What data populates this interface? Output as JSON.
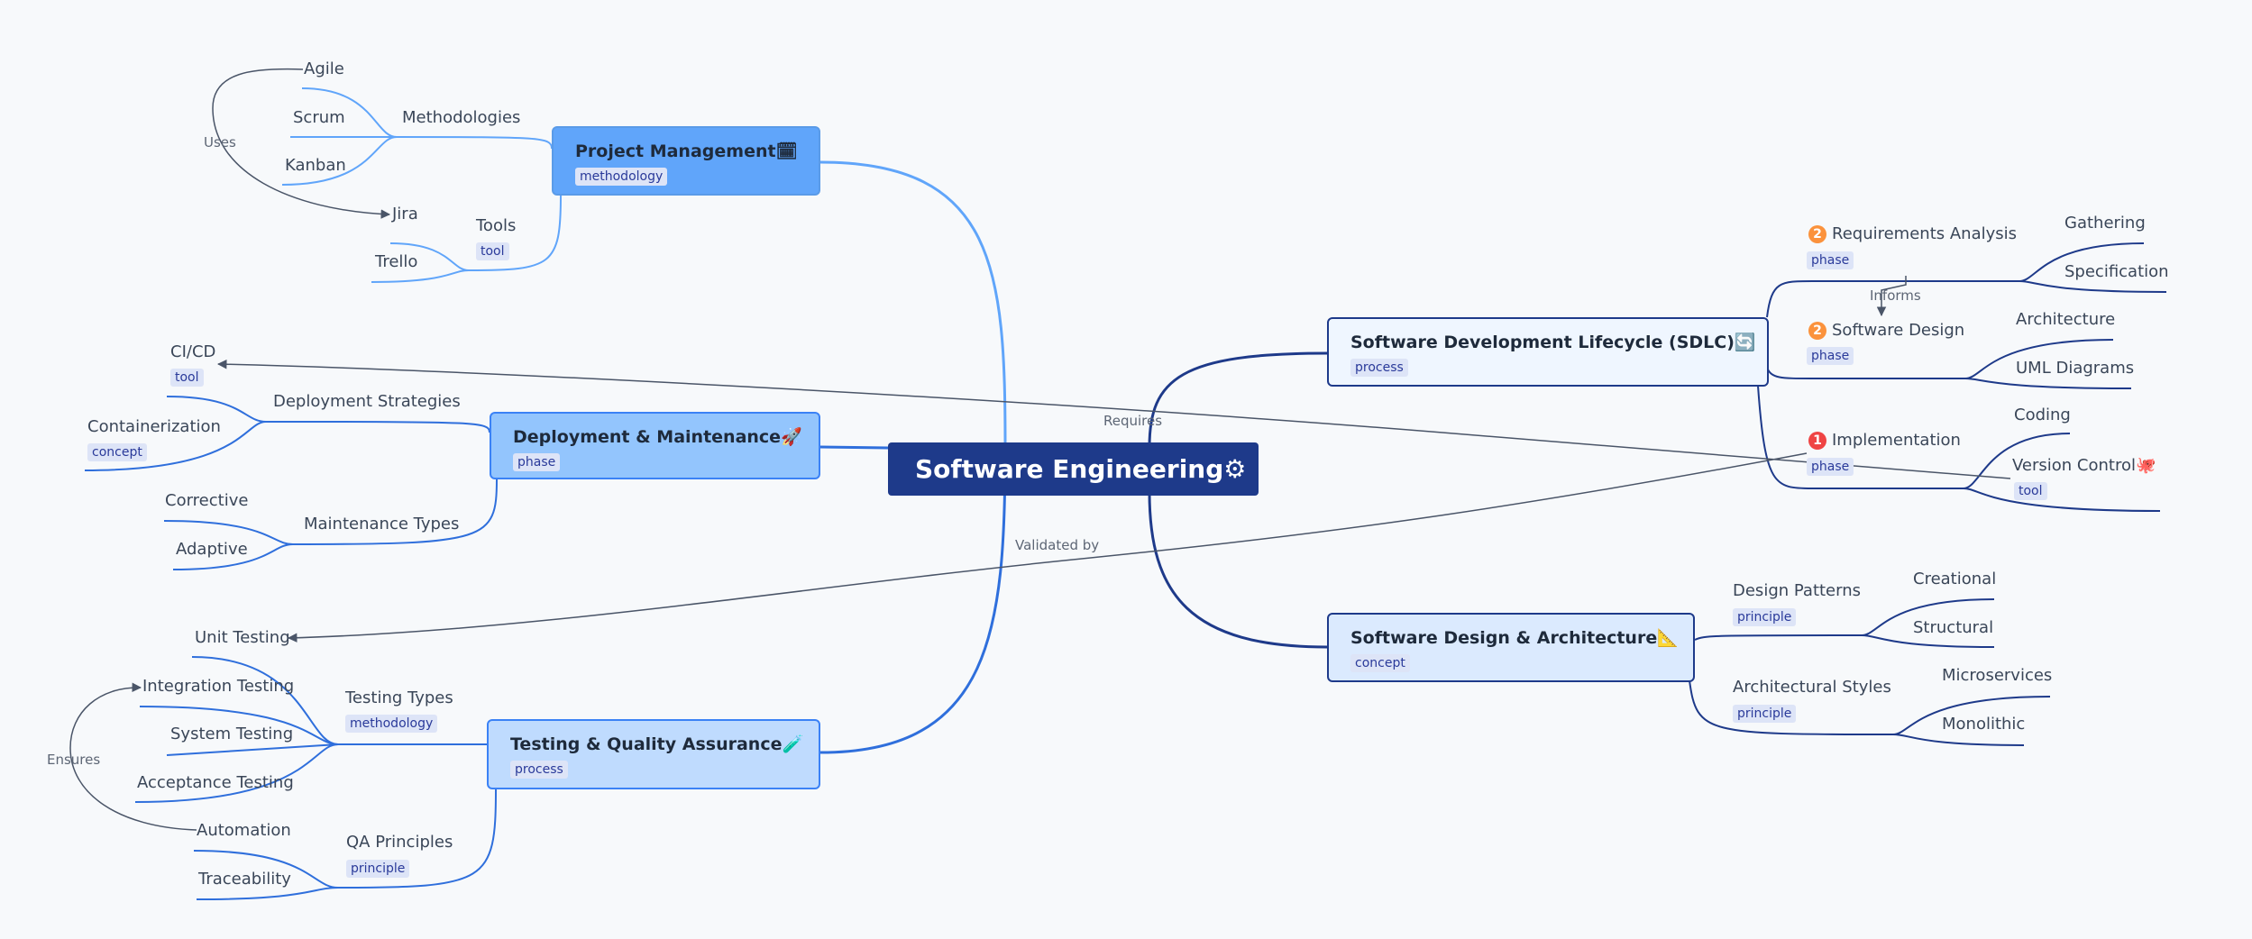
{
  "root": {
    "title": "Software Engineering",
    "emoji": "⚙"
  },
  "branches": {
    "project_management": {
      "title": "Project Management",
      "emoji": "🗓",
      "tag": "methodology",
      "color": "#60a5fa"
    },
    "deployment": {
      "title": "Deployment & Maintenance",
      "emoji": "🚀",
      "tag": "phase",
      "color": "#93c5fd"
    },
    "testing": {
      "title": "Testing & Quality Assurance",
      "emoji": "🧪",
      "tag": "process",
      "color": "#bfdbfe"
    },
    "sdlc": {
      "title": "Software Development Lifecycle (SDLC)",
      "emoji": "🔄",
      "tag": "process",
      "color": "#eff6ff"
    },
    "design": {
      "title": "Software Design & Architecture",
      "emoji": "📐",
      "tag": "concept",
      "color": "#dbeafe"
    }
  },
  "pm": {
    "methodologies": {
      "label": "Methodologies",
      "items": [
        "Agile",
        "Scrum",
        "Kanban"
      ]
    },
    "tools": {
      "label": "Tools",
      "tag": "tool",
      "items": [
        "Jira",
        "Trello"
      ]
    }
  },
  "deploy": {
    "strategies": {
      "label": "Deployment Strategies",
      "cicd": "CI/CD",
      "cicd_tag": "tool",
      "containerization": "Containerization",
      "containerization_tag": "concept"
    },
    "maintenance": {
      "label": "Maintenance Types",
      "items": [
        "Corrective",
        "Adaptive"
      ]
    }
  },
  "test": {
    "types": {
      "label": "Testing Types",
      "tag": "methodology",
      "items": [
        "Unit Testing",
        "Integration Testing",
        "System Testing",
        "Acceptance Testing"
      ]
    },
    "qa": {
      "label": "QA Principles",
      "tag": "principle",
      "items": [
        "Automation",
        "Traceability"
      ]
    }
  },
  "sdlc_children": {
    "requirements": {
      "label": "Requirements Analysis",
      "badge": "2",
      "tag": "phase",
      "items": [
        "Gathering",
        "Specification"
      ]
    },
    "design": {
      "label": "Software Design",
      "badge": "2",
      "tag": "phase",
      "items": [
        "Architecture",
        "UML Diagrams"
      ]
    },
    "implementation": {
      "label": "Implementation",
      "badge": "1",
      "tag": "phase",
      "coding": "Coding",
      "vc": "Version Control",
      "vc_emoji": "🐙",
      "vc_tag": "tool"
    }
  },
  "design_children": {
    "patterns": {
      "label": "Design Patterns",
      "tag": "principle",
      "items": [
        "Creational",
        "Structural"
      ]
    },
    "styles": {
      "label": "Architectural Styles",
      "tag": "principle",
      "items": [
        "Microservices",
        "Monolithic"
      ]
    }
  },
  "relations": {
    "uses": "Uses",
    "requires": "Requires",
    "validated_by": "Validated by",
    "ensures": "Ensures",
    "informs": "Informs"
  },
  "colors": {
    "root": "#1e3a8a",
    "dark_branch": "#1e3a8a",
    "light_branch": "#2f6fdc",
    "badge_orange": "#fb923c",
    "badge_red": "#ef4444"
  }
}
